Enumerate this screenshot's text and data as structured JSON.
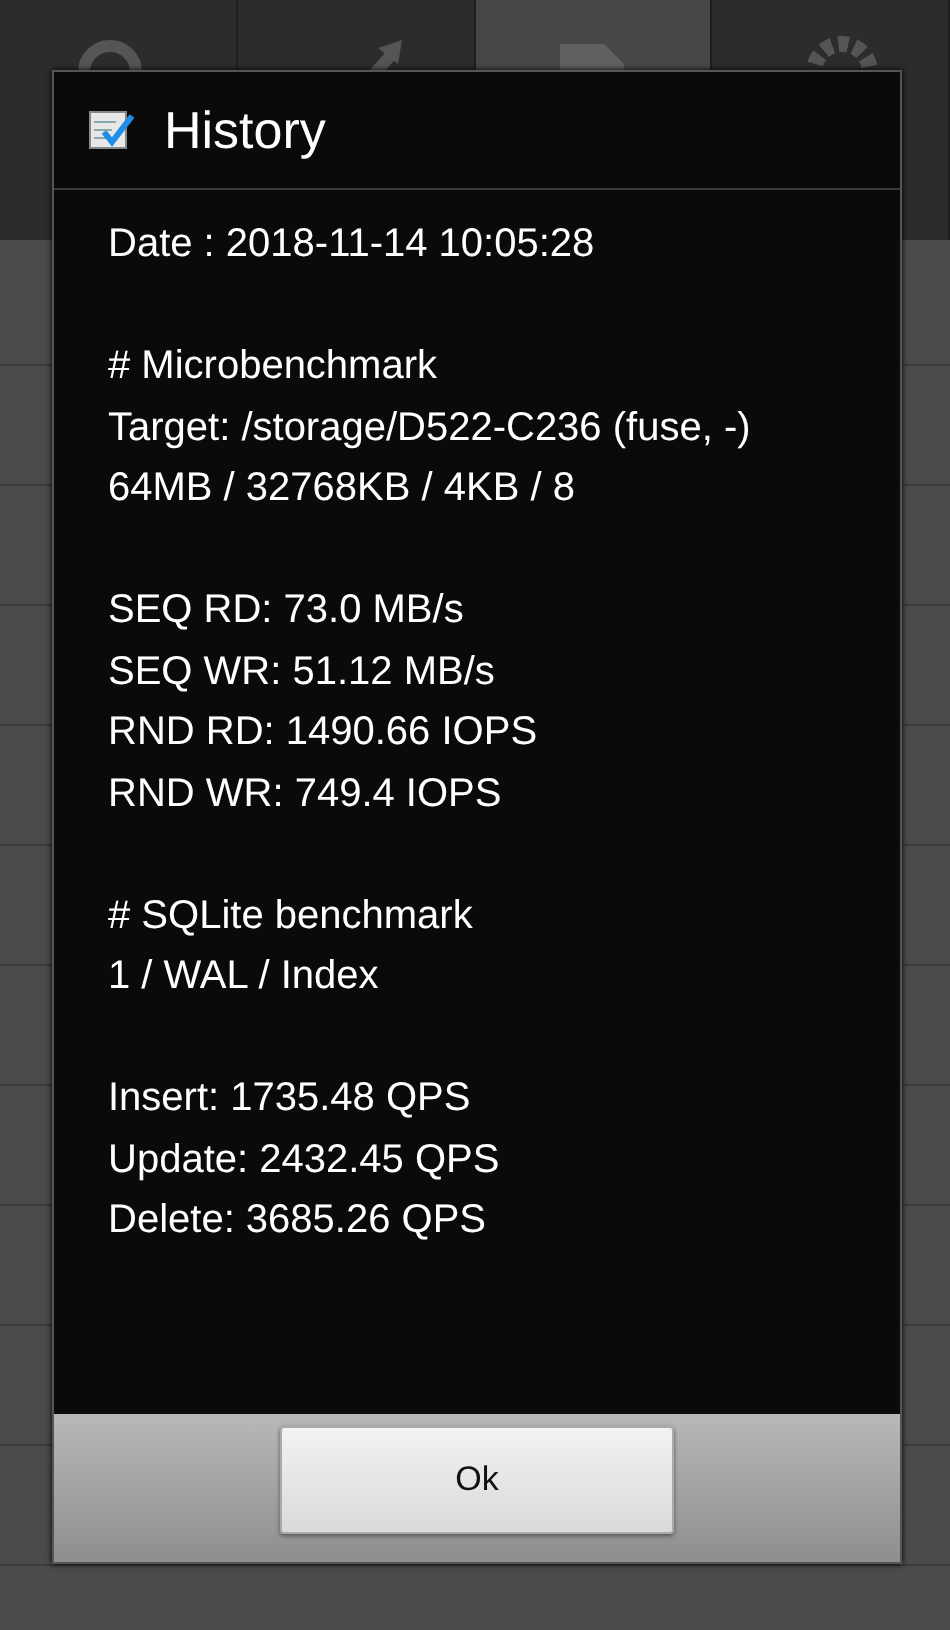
{
  "tabs": [
    {
      "selected": false
    },
    {
      "selected": false
    },
    {
      "selected": true
    },
    {
      "selected": false
    }
  ],
  "dialog": {
    "title": "History",
    "sections": [
      [
        "Date : 2018-11-14 10:05:28"
      ],
      [
        "# Microbenchmark",
        "Target: /storage/D522-C236 (fuse, -)",
        "64MB / 32768KB / 4KB / 8"
      ],
      [
        "SEQ RD: 73.0 MB/s",
        "SEQ WR: 51.12 MB/s",
        "RND RD: 1490.66 IOPS",
        "RND WR: 749.4 IOPS"
      ],
      [
        "# SQLite benchmark",
        "1 / WAL / Index"
      ],
      [
        "Insert: 1735.48 QPS",
        "Update: 2432.45 QPS",
        "Delete: 3685.26 QPS"
      ]
    ],
    "buttons": [
      "Ok"
    ]
  }
}
